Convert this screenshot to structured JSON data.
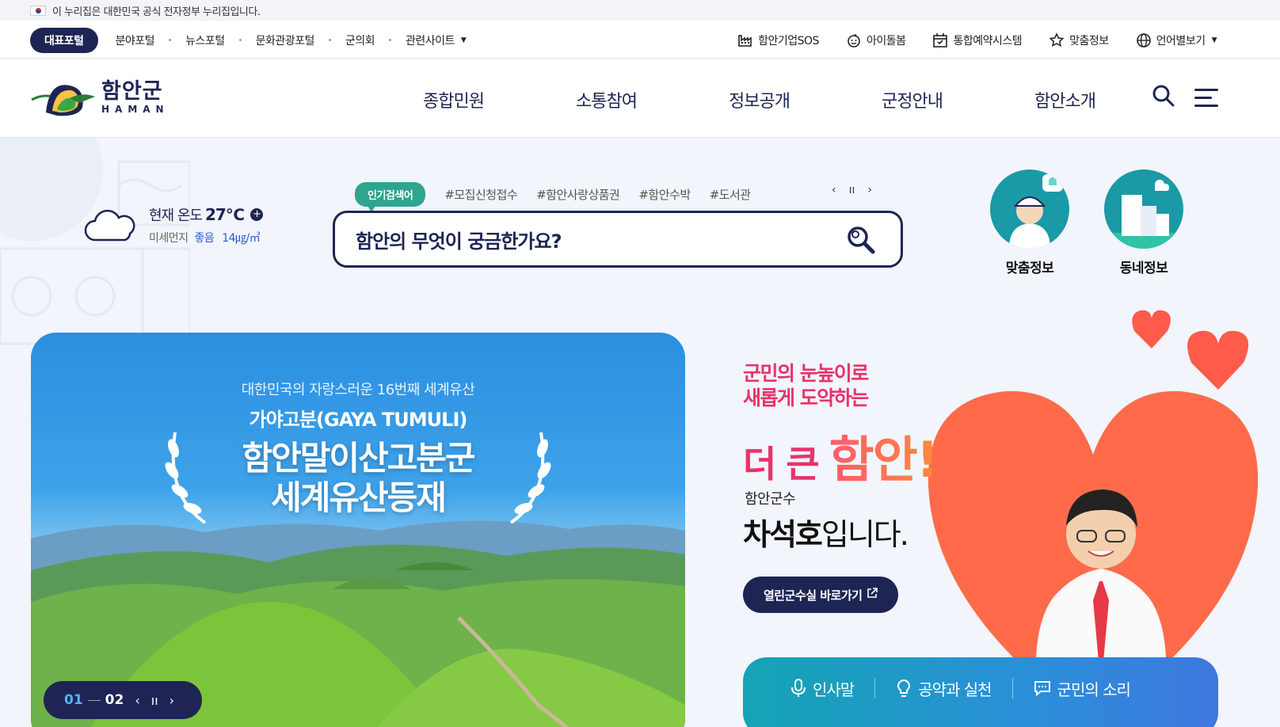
{
  "gov_notice": "이 누리집은 대한민국 공식 전자정부 누리집입니다.",
  "portal": {
    "tabs": [
      "대표포털",
      "분야포털",
      "뉴스포털",
      "문화관광포털",
      "군의회",
      "관련사이트"
    ],
    "utilities": [
      {
        "label": "함안기업SOS",
        "icon": "factory-icon"
      },
      {
        "label": "아이돌봄",
        "icon": "baby-face-icon"
      },
      {
        "label": "통합예약시스템",
        "icon": "calendar-icon"
      },
      {
        "label": "맞춤정보",
        "icon": "star-person-icon"
      },
      {
        "label": "언어별보기",
        "icon": "globe-icon"
      }
    ]
  },
  "logo": {
    "ko": "함안군",
    "en": "HAMAN"
  },
  "gnb": [
    "종합민원",
    "소통참여",
    "정보공개",
    "군정안내",
    "함안소개"
  ],
  "weather": {
    "temp_label": "현재 온도",
    "temp_value": "27℃",
    "dust_label": "미세먼지",
    "dust_status": "좋음",
    "dust_value": "14㎍/㎥"
  },
  "popular": {
    "badge": "인기검색어",
    "tags": [
      "#모집신청접수",
      "#함안사랑상품권",
      "#함안수박",
      "#도서관"
    ]
  },
  "search": {
    "placeholder": "함안의 무엇이 궁금한가요?"
  },
  "quick_links": [
    {
      "label": "맞춤정보"
    },
    {
      "label": "동네정보"
    }
  ],
  "banner": {
    "sub": "대한민국의 자랑스러운 16번째 세계유산",
    "sub2": "가야고분(GAYA TUMULI)",
    "main_line1": "함안말이산고분군",
    "main_line2": "세계유산등재",
    "current": "01",
    "total": "02"
  },
  "mayor": {
    "slogan_line1": "군민의 눈높이로",
    "slogan_line2": "새롭게 도약하는",
    "big_a": "더 큰 ",
    "big_b": "함안!",
    "title": "함안군수",
    "name": "차석호",
    "name_suffix": "입니다.",
    "link_label": "열린군수실 바로가기",
    "tabs": [
      "인사말",
      "공약과 실천",
      "군민의 소리"
    ]
  },
  "colors": {
    "navy": "#1e2554",
    "pink": "#e8336b",
    "teal": "#2fa58e"
  }
}
